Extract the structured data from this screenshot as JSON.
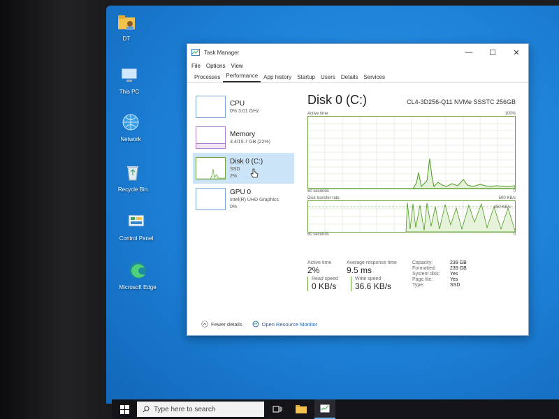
{
  "desktop": {
    "icons": [
      {
        "label": "DT"
      },
      {
        "label": "This PC"
      },
      {
        "label": "Network"
      },
      {
        "label": "Recycle Bin"
      },
      {
        "label": "Control Panel"
      },
      {
        "label": "Microsoft Edge"
      }
    ]
  },
  "taskbar": {
    "search_placeholder": "Type here to search"
  },
  "window": {
    "title": "Task Manager",
    "controls": {
      "minimize": "—",
      "maximize": "☐",
      "close": "✕"
    },
    "menu": [
      "File",
      "Options",
      "View"
    ],
    "tabs": [
      "Processes",
      "Performance",
      "App history",
      "Startup",
      "Users",
      "Details",
      "Services"
    ],
    "active_tab": "Performance"
  },
  "sidebar": {
    "items": [
      {
        "name": "CPU",
        "line1": "0% 3.01 GHz",
        "line2": ""
      },
      {
        "name": "Memory",
        "line1": "3.4/15.7 GB (22%)",
        "line2": ""
      },
      {
        "name": "Disk 0 (C:)",
        "line1": "SSD",
        "line2": "2%"
      },
      {
        "name": "GPU 0",
        "line1": "Intel(R) UHD Graphics",
        "line2": "0%"
      }
    ],
    "selected_index": 2
  },
  "detail": {
    "title": "Disk 0 (C:)",
    "model": "CL4-3D256-Q11 NVMe SSSTC 256GB",
    "graph1": {
      "label": "Active time",
      "max": "100%",
      "time": "60 seconds",
      "min": "0"
    },
    "graph2": {
      "label": "Disk transfer rate",
      "max": "500 KB/s",
      "marker": "450 KB/s",
      "time": "60 seconds",
      "min": "0"
    },
    "stats": {
      "active_time_label": "Active time",
      "active_time": "2%",
      "avg_response_label": "Average response time",
      "avg_response": "9.5 ms",
      "read_label": "Read speed",
      "read": "0 KB/s",
      "write_label": "Write speed",
      "write": "36.6 KB/s",
      "props": [
        {
          "k": "Capacity:",
          "v": "239 GB"
        },
        {
          "k": "Formatted:",
          "v": "239 GB"
        },
        {
          "k": "System disk:",
          "v": "Yes"
        },
        {
          "k": "Page file:",
          "v": "Yes"
        },
        {
          "k": "Type:",
          "v": "SSD"
        }
      ]
    }
  },
  "footer": {
    "fewer_details": "Fewer details",
    "open_monitor": "Open Resource Monitor"
  },
  "colors": {
    "disk_line": "#4c9a1f",
    "disk_fill": "#e6f2da",
    "grid": "#e8efe2",
    "selected_bg": "#cce4f7",
    "desktop": "#1c7fd6"
  }
}
